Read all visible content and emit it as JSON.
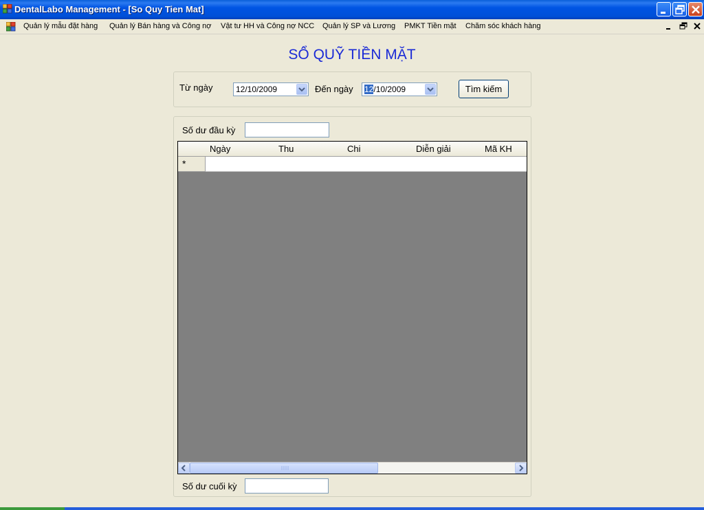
{
  "window": {
    "title": "DentalLabo Management - [So Quy Tien Mat]"
  },
  "menu": {
    "items": [
      "Quản lý mẫu đặt hàng",
      "Quản lý Bán hàng và Công nợ",
      "Vật tư HH và Công nợ NCC",
      "Quản lý SP và Lương",
      "PMKT Tiền mặt",
      "Chăm sóc khách hàng"
    ]
  },
  "form": {
    "title": "SỔ QUỸ TIỀN MẶT",
    "from_label": "Từ ngày",
    "from_value": "12/10/2009",
    "to_label": "Đến ngày",
    "to_value_selected": "12",
    "to_value_rest": "/10/2009",
    "search_button": "Tìm kiếm",
    "opening_balance_label": "Số dư đầu kỳ",
    "opening_balance_value": "",
    "closing_balance_label": "Số dư cuối kỳ",
    "closing_balance_value": ""
  },
  "grid": {
    "columns": [
      "Ngày",
      "Thu",
      "Chi",
      "Diễn giải",
      "Mã KH"
    ],
    "new_row_marker": "*"
  },
  "colors": {
    "title_blue": "#1a2ad6",
    "titlebar": "#0054e3",
    "grid_background": "#808080"
  }
}
